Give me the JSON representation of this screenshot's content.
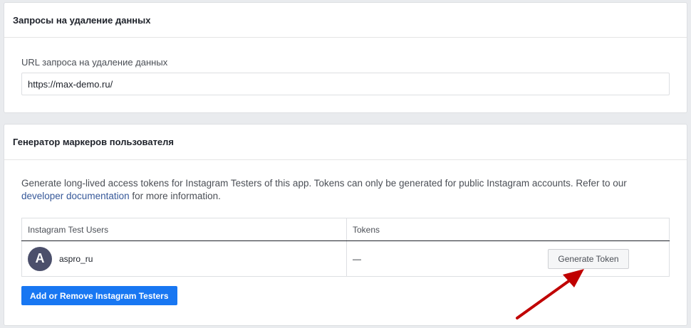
{
  "deletion": {
    "title": "Запросы на удаление данных",
    "url_label": "URL запроса на удаление данных",
    "url_value": "https://max-demo.ru/"
  },
  "token_generator": {
    "title": "Генератор маркеров пользователя",
    "description_prefix": "Generate long-lived access tokens for Instagram Testers of this app. Tokens can only be generated for public Instagram accounts. Refer to our ",
    "link_text": "developer documentation",
    "description_suffix": " for more information.",
    "table": {
      "headers": [
        "Instagram Test Users",
        "Tokens"
      ],
      "rows": [
        {
          "avatar_letter": "A",
          "username": "aspro_ru",
          "token": "—",
          "action_label": "Generate Token"
        }
      ]
    },
    "add_button_label": "Add or Remove Instagram Testers"
  },
  "colors": {
    "primary_button": "#1877f2",
    "link": "#365899",
    "annotation_arrow": "#c00000",
    "avatar_bg": "#4b4f6b"
  },
  "icons": {
    "annotation": "red-arrow-icon"
  }
}
